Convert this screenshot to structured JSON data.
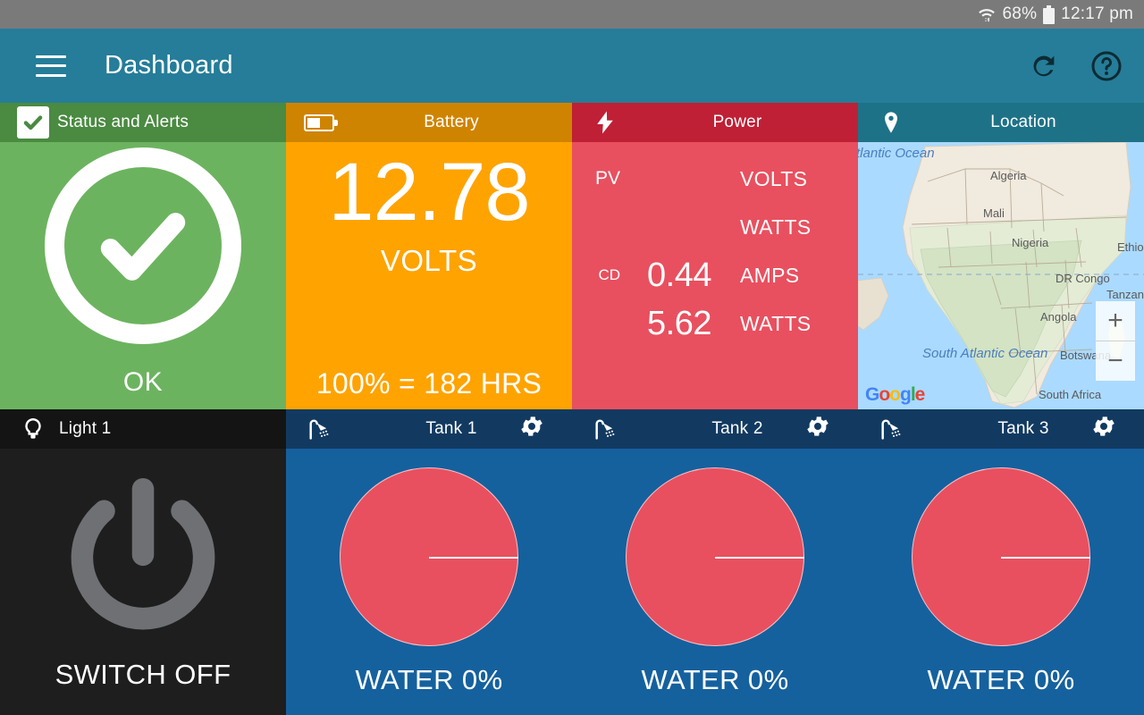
{
  "statusbar": {
    "wifi_icon": "wifi-icon",
    "battery_percent": "68%",
    "battery_icon": "battery-icon",
    "time": "12:17 pm"
  },
  "appbar": {
    "menu_icon": "hamburger-menu-icon",
    "title": "Dashboard",
    "refresh_icon": "refresh-icon",
    "help_icon": "help-icon"
  },
  "panels": {
    "status": {
      "header_icon": "checkbox-checked-icon",
      "title": "Status and Alerts",
      "state_icon": "check-circle-icon",
      "state_label": "OK",
      "header_color": "#4a8a41",
      "body_color": "#6cb35f"
    },
    "battery": {
      "header_icon": "battery-horizontal-icon",
      "title": "Battery",
      "value": "12.78",
      "unit": "VOLTS",
      "footer": "100% = 182 HRS",
      "header_color": "#cf8400",
      "body_color": "#ffa300"
    },
    "power": {
      "header_icon": "lightning-bolt-icon",
      "title": "Power",
      "header_color": "#bf2035",
      "body_color": "#e8505f",
      "rows": [
        {
          "tag": "PV",
          "value": "",
          "unit": "VOLTS"
        },
        {
          "tag": "",
          "value": "",
          "unit": "WATTS"
        },
        {
          "tag": "CD",
          "value": "0.44",
          "unit": "AMPS"
        },
        {
          "tag": "",
          "value": "5.62",
          "unit": "WATTS"
        }
      ]
    },
    "location": {
      "header_icon": "map-pin-icon",
      "title": "Location",
      "header_color": "#1e7287",
      "map_attribution": "Google",
      "zoom_in_label": "+",
      "zoom_out_label": "−",
      "map_labels": [
        "Atlantic Ocean",
        "Algeria",
        "Mali",
        "Nigeria",
        "Ethiop",
        "DR Congo",
        "Tanzania",
        "Angola",
        "Botswana",
        "South Africa",
        "South Atlantic Ocean"
      ]
    },
    "light1": {
      "header_icon": "light-bulb-icon",
      "title": "Light 1",
      "power_icon": "power-symbol-icon",
      "state_label": "SWITCH OFF",
      "header_color": "#141414",
      "body_color": "#1e1e1e"
    },
    "tanks": [
      {
        "header_icon": "shower-icon",
        "title": "Tank 1",
        "gear_icon": "gear-icon",
        "level_label": "WATER 0%",
        "level_percent": 0
      },
      {
        "header_icon": "shower-icon",
        "title": "Tank 2",
        "gear_icon": "gear-icon",
        "level_label": "WATER 0%",
        "level_percent": 0
      },
      {
        "header_icon": "shower-icon",
        "title": "Tank 3",
        "gear_icon": "gear-icon",
        "level_label": "WATER 0%",
        "level_percent": 0
      }
    ]
  }
}
